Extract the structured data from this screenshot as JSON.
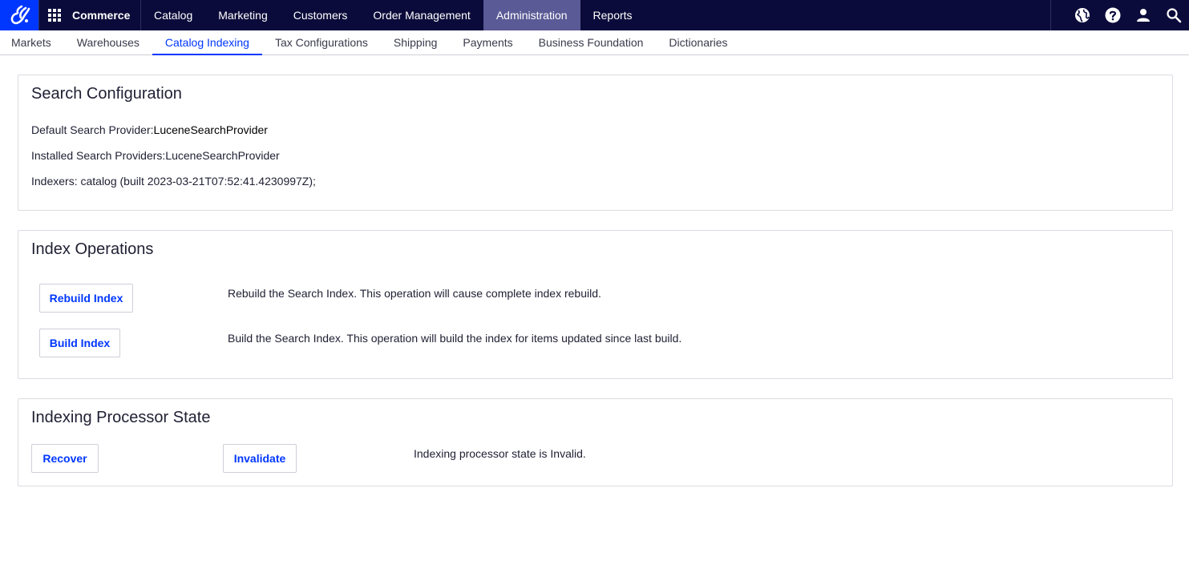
{
  "topbar": {
    "app_name": "Commerce",
    "nav": [
      {
        "label": "Catalog"
      },
      {
        "label": "Marketing"
      },
      {
        "label": "Customers"
      },
      {
        "label": "Order Management"
      },
      {
        "label": "Administration",
        "active": true
      },
      {
        "label": "Reports"
      }
    ],
    "icons": [
      "globe-icon",
      "help-icon",
      "user-icon",
      "search-icon"
    ],
    "colors": {
      "background": "#0b0b3b",
      "logo_bg": "#0037ff",
      "active_bg": "#5a5a96"
    }
  },
  "subnav": {
    "items": [
      {
        "label": "Markets"
      },
      {
        "label": "Warehouses"
      },
      {
        "label": "Catalog Indexing",
        "active": true
      },
      {
        "label": "Tax Configurations"
      },
      {
        "label": "Shipping"
      },
      {
        "label": "Payments"
      },
      {
        "label": "Business Foundation"
      },
      {
        "label": "Dictionaries"
      }
    ],
    "accent": "#0037ff"
  },
  "search_configuration": {
    "title": "Search Configuration",
    "default_provider_label": "Default Search Provider:",
    "default_provider_value": "LuceneSearchProvider",
    "installed_providers": "Installed Search Providers:LuceneSearchProvider",
    "indexers": "Indexers: catalog (built 2023-03-21T07:52:41.4230997Z);"
  },
  "index_operations": {
    "title": "Index Operations",
    "rebuild_button": "Rebuild Index",
    "rebuild_description": "Rebuild the Search Index. This operation will cause complete index rebuild.",
    "build_button": "Build Index",
    "build_description": "Build the Search Index. This operation will build the index for items updated since last build."
  },
  "processor_state": {
    "title": "Indexing Processor State",
    "recover_button": "Recover",
    "invalidate_button": "Invalidate",
    "status_text": "Indexing processor state is Invalid."
  }
}
